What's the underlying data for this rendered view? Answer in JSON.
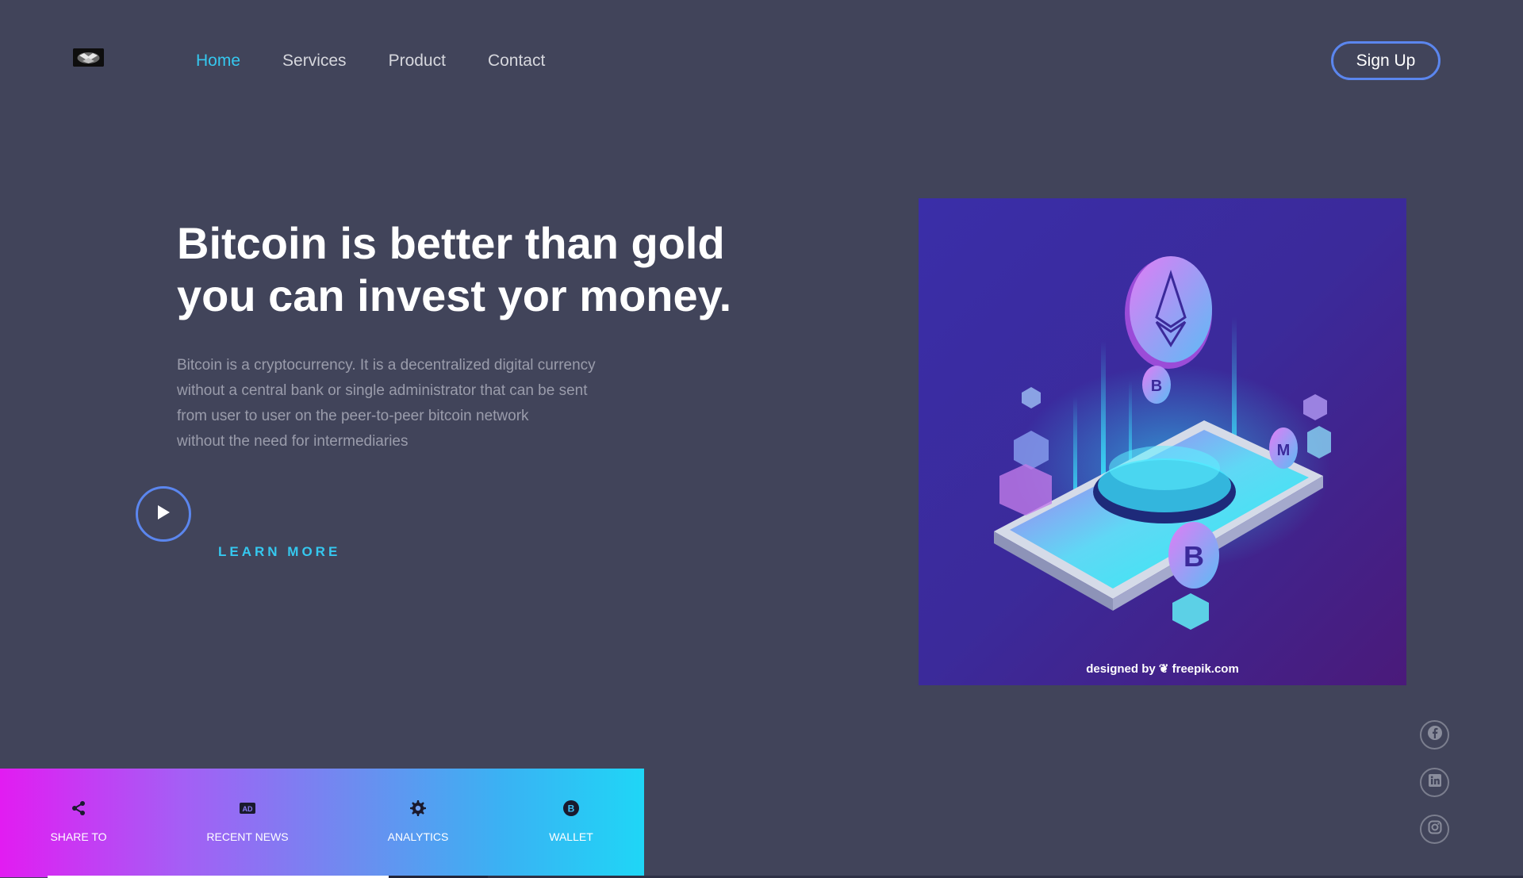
{
  "header": {
    "nav": [
      {
        "label": "Home",
        "active": true
      },
      {
        "label": "Services",
        "active": false
      },
      {
        "label": "Product",
        "active": false
      },
      {
        "label": "Contact",
        "active": false
      }
    ],
    "signup_label": "Sign Up"
  },
  "hero": {
    "title_lines": [
      "Bitcoin is better than gold",
      "you can invest yor money."
    ],
    "description_lines": [
      "Bitcoin is a cryptocurrency. It is a decentralized digital currency",
      "without a central bank or single administrator that can be sent",
      "from user to user on the peer-to-peer bitcoin network",
      "without the need for intermediaries"
    ],
    "learn_more_label": "LEARN MORE"
  },
  "illustration": {
    "credit": "designed by ❦ freepik.com"
  },
  "bottom_bar": {
    "items": [
      {
        "label": "SHARE TO",
        "icon": "share-icon"
      },
      {
        "label": "RECENT NEWS",
        "icon": "ad-icon"
      },
      {
        "label": "ANALYTICS",
        "icon": "gear-icon"
      },
      {
        "label": "WALLET",
        "icon": "bitcoin-icon"
      }
    ]
  },
  "social": [
    "facebook-icon",
    "linkedin-icon",
    "instagram-icon"
  ],
  "colors": {
    "background": "#41445a",
    "accent_cyan": "#35c8ef",
    "accent_blue": "#5b86ee",
    "bar_gradient_start": "#e21cf2",
    "bar_gradient_end": "#1fd6f6"
  }
}
